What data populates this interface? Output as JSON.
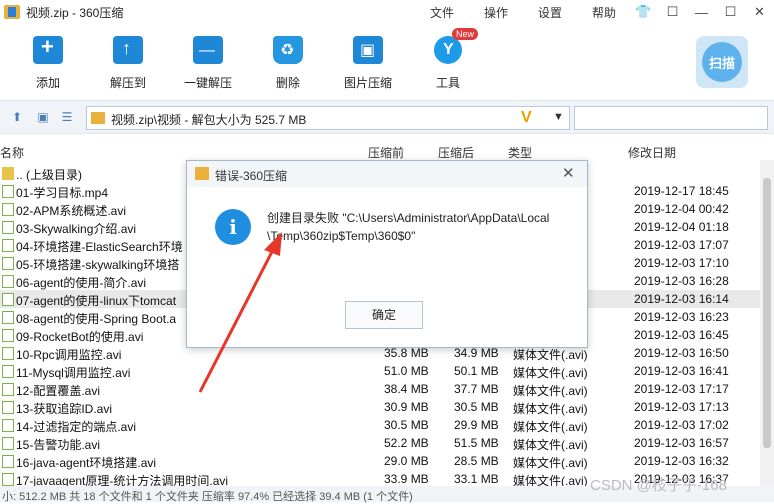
{
  "window": {
    "title": "视频.zip - 360压缩",
    "menus": [
      "文件",
      "操作",
      "设置",
      "帮助"
    ],
    "controls": [
      "👕",
      "☐",
      "—",
      "☐",
      "✕"
    ]
  },
  "toolbar": {
    "add": "添加",
    "extract_to": "解压到",
    "one_click_extract": "一键解压",
    "delete": "删除",
    "image_compress": "图片压缩",
    "tools": "工具",
    "new_badge": "New",
    "scan": "扫描"
  },
  "address": {
    "path": "视频.zip\\视频 - 解包大小为 525.7 MB",
    "v_mark": "V",
    "dropdown": "▼",
    "search_placeholder": ""
  },
  "columns": {
    "name": "名称",
    "size": "压缩前",
    "csize": "压缩后",
    "type": "类型",
    "date": "修改日期"
  },
  "rows": [
    {
      "name": ".. (上级目录)",
      "size": "",
      "csize": "",
      "type": "",
      "date": "",
      "folder": true
    },
    {
      "name": "01-学习目标.mp4",
      "size": "",
      "csize": "",
      "type": "4)",
      "date": "2019-12-17 18:45"
    },
    {
      "name": "02-APM系统概述.avi",
      "size": "",
      "csize": "",
      "type": "",
      "date": "2019-12-04 00:42"
    },
    {
      "name": "03-Skywalking介绍.avi",
      "size": "",
      "csize": "",
      "type": "",
      "date": "2019-12-04 01:18"
    },
    {
      "name": "04-环境搭建-ElasticSearch环境",
      "size": "",
      "csize": "",
      "type": "",
      "date": "2019-12-03 17:07"
    },
    {
      "name": "05-环境搭建-skywalking环境搭",
      "size": "",
      "csize": "",
      "type": "",
      "date": "2019-12-03 17:10"
    },
    {
      "name": "06-agent的使用-简介.avi",
      "size": "",
      "csize": "",
      "type": "",
      "date": "2019-12-03 16:28"
    },
    {
      "name": "07-agent的使用-linux下tomcat",
      "size": "",
      "csize": "",
      "type": "",
      "date": "2019-12-03 16:14",
      "selected": true
    },
    {
      "name": "08-agent的使用-Spring Boot.a",
      "size": "",
      "csize": "",
      "type": "",
      "date": "2019-12-03 16:23"
    },
    {
      "name": "09-RocketBot的使用.avi",
      "size": "",
      "csize": "",
      "type": "",
      "date": "2019-12-03 16:45"
    },
    {
      "name": "10-Rpc调用监控.avi",
      "size": "35.8 MB",
      "csize": "34.9 MB",
      "type": "媒体文件(.avi)",
      "date": "2019-12-03 16:50"
    },
    {
      "name": "11-Mysql调用监控.avi",
      "size": "51.0 MB",
      "csize": "50.1 MB",
      "type": "媒体文件(.avi)",
      "date": "2019-12-03 16:41"
    },
    {
      "name": "12-配置覆盖.avi",
      "size": "38.4 MB",
      "csize": "37.7 MB",
      "type": "媒体文件(.avi)",
      "date": "2019-12-03 17:17"
    },
    {
      "name": "13-获取追踪ID.avi",
      "size": "30.9 MB",
      "csize": "30.5 MB",
      "type": "媒体文件(.avi)",
      "date": "2019-12-03 17:13"
    },
    {
      "name": "14-过滤指定的端点.avi",
      "size": "30.5 MB",
      "csize": "29.9 MB",
      "type": "媒体文件(.avi)",
      "date": "2019-12-03 17:02"
    },
    {
      "name": "15-告警功能.avi",
      "size": "52.2 MB",
      "csize": "51.5 MB",
      "type": "媒体文件(.avi)",
      "date": "2019-12-03 16:57"
    },
    {
      "name": "16-java-agent环境搭建.avi",
      "size": "29.0 MB",
      "csize": "28.5 MB",
      "type": "媒体文件(.avi)",
      "date": "2019-12-03 16:32"
    },
    {
      "name": "17-javaagent原理-统计方法调用时间.avi",
      "size": "33.9 MB",
      "csize": "33.1 MB",
      "type": "媒体文件(.avi)",
      "date": "2019-12-03 16:37"
    }
  ],
  "status": {
    "left": "小: 512.2 MB 共 18 个文件和 1 个文件夹 压缩率 97.4% 已经选择 39.4 MB (1 个文件)"
  },
  "watermark": "CSDN @枝子子-168",
  "dialog": {
    "title": "错误-360压缩",
    "close": "✕",
    "icon": "i",
    "line1": "创建目录失败 \"C:\\Users\\Administrator\\AppData\\Local",
    "line2": "\\Temp\\360zip$Temp\\360$0\"",
    "ok": "确定"
  },
  "colors": {
    "accent": "#1e88d6",
    "annotation_arrow": "#e8352a"
  }
}
